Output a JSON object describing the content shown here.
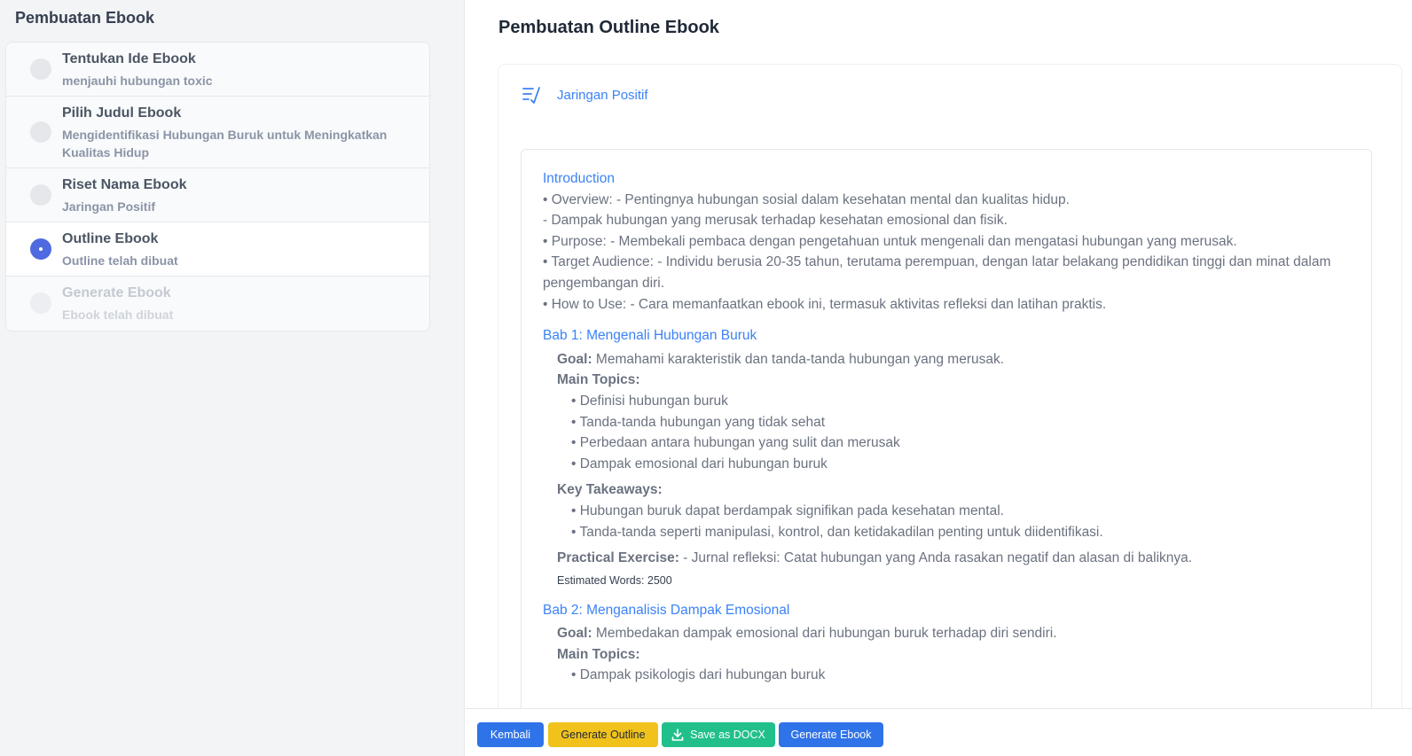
{
  "sidebar": {
    "title": "Pembuatan Ebook",
    "steps": [
      {
        "title": "Tentukan Ide Ebook",
        "subtitle": "menjauhi hubungan toxic",
        "state": "done"
      },
      {
        "title": "Pilih Judul Ebook",
        "subtitle": "Mengidentifikasi Hubungan Buruk untuk Meningkatkan Kualitas Hidup",
        "state": "done"
      },
      {
        "title": "Riset Nama Ebook",
        "subtitle": "Jaringan Positif",
        "state": "done"
      },
      {
        "title": "Outline Ebook",
        "subtitle": "Outline telah dibuat",
        "state": "active"
      },
      {
        "title": "Generate Ebook",
        "subtitle": "Ebook telah dibuat",
        "state": "disabled"
      }
    ]
  },
  "main": {
    "title": "Pembuatan Outline Ebook",
    "card": {
      "icon": "list-check-icon",
      "ebook_name": "Jaringan Positif"
    },
    "outline": {
      "introduction": {
        "heading": "Introduction",
        "lines": [
          "• Overview: - Pentingnya hubungan sosial dalam kesehatan mental dan kualitas hidup.",
          "- Dampak hubungan yang merusak terhadap kesehatan emosional dan fisik.",
          "• Purpose: - Membekali pembaca dengan pengetahuan untuk mengenali dan mengatasi hubungan yang merusak.",
          "• Target Audience: - Individu berusia 20-35 tahun, terutama perempuan, dengan latar belakang pendidikan tinggi dan minat dalam pengembangan diri.",
          "• How to Use: - Cara memanfaatkan ebook ini, termasuk aktivitas refleksi dan latihan praktis."
        ]
      },
      "chapters": [
        {
          "heading": "Bab 1: Mengenali Hubungan Buruk",
          "goal_label": "Goal:",
          "goal": " Memahami karakteristik dan tanda-tanda hubungan yang merusak.",
          "topics_label": "Main Topics:",
          "topics": [
            "• Definisi hubungan buruk",
            "• Tanda-tanda hubungan yang tidak sehat",
            "• Perbedaan antara hubungan yang sulit dan merusak",
            "• Dampak emosional dari hubungan buruk"
          ],
          "takeaways_label": "Key Takeaways:",
          "takeaways": [
            "• Hubungan buruk dapat berdampak signifikan pada kesehatan mental.",
            "• Tanda-tanda seperti manipulasi, kontrol, dan ketidakadilan penting untuk diidentifikasi."
          ],
          "exercise_label": "Practical Exercise:",
          "exercise": " - Jurnal refleksi: Catat hubungan yang Anda rasakan negatif dan alasan di baliknya.",
          "estimated_words": "Estimated Words: 2500"
        },
        {
          "heading": "Bab 2: Menganalisis Dampak Emosional",
          "goal_label": "Goal:",
          "goal": " Membedakan dampak emosional dari hubungan buruk terhadap diri sendiri.",
          "topics_label": "Main Topics:",
          "topics": [
            "• Dampak psikologis dari hubungan buruk"
          ]
        }
      ]
    }
  },
  "buttons": {
    "back": "Kembali",
    "generate_outline": "Generate Outline",
    "save_docx": "Save as DOCX",
    "generate_ebook": "Generate Ebook"
  },
  "colors": {
    "accent_blue": "#2f73e8",
    "link_blue": "#3b82f6",
    "yellow": "#f1c21b",
    "green": "#21c08b",
    "active_dot": "#4f6ae0"
  }
}
